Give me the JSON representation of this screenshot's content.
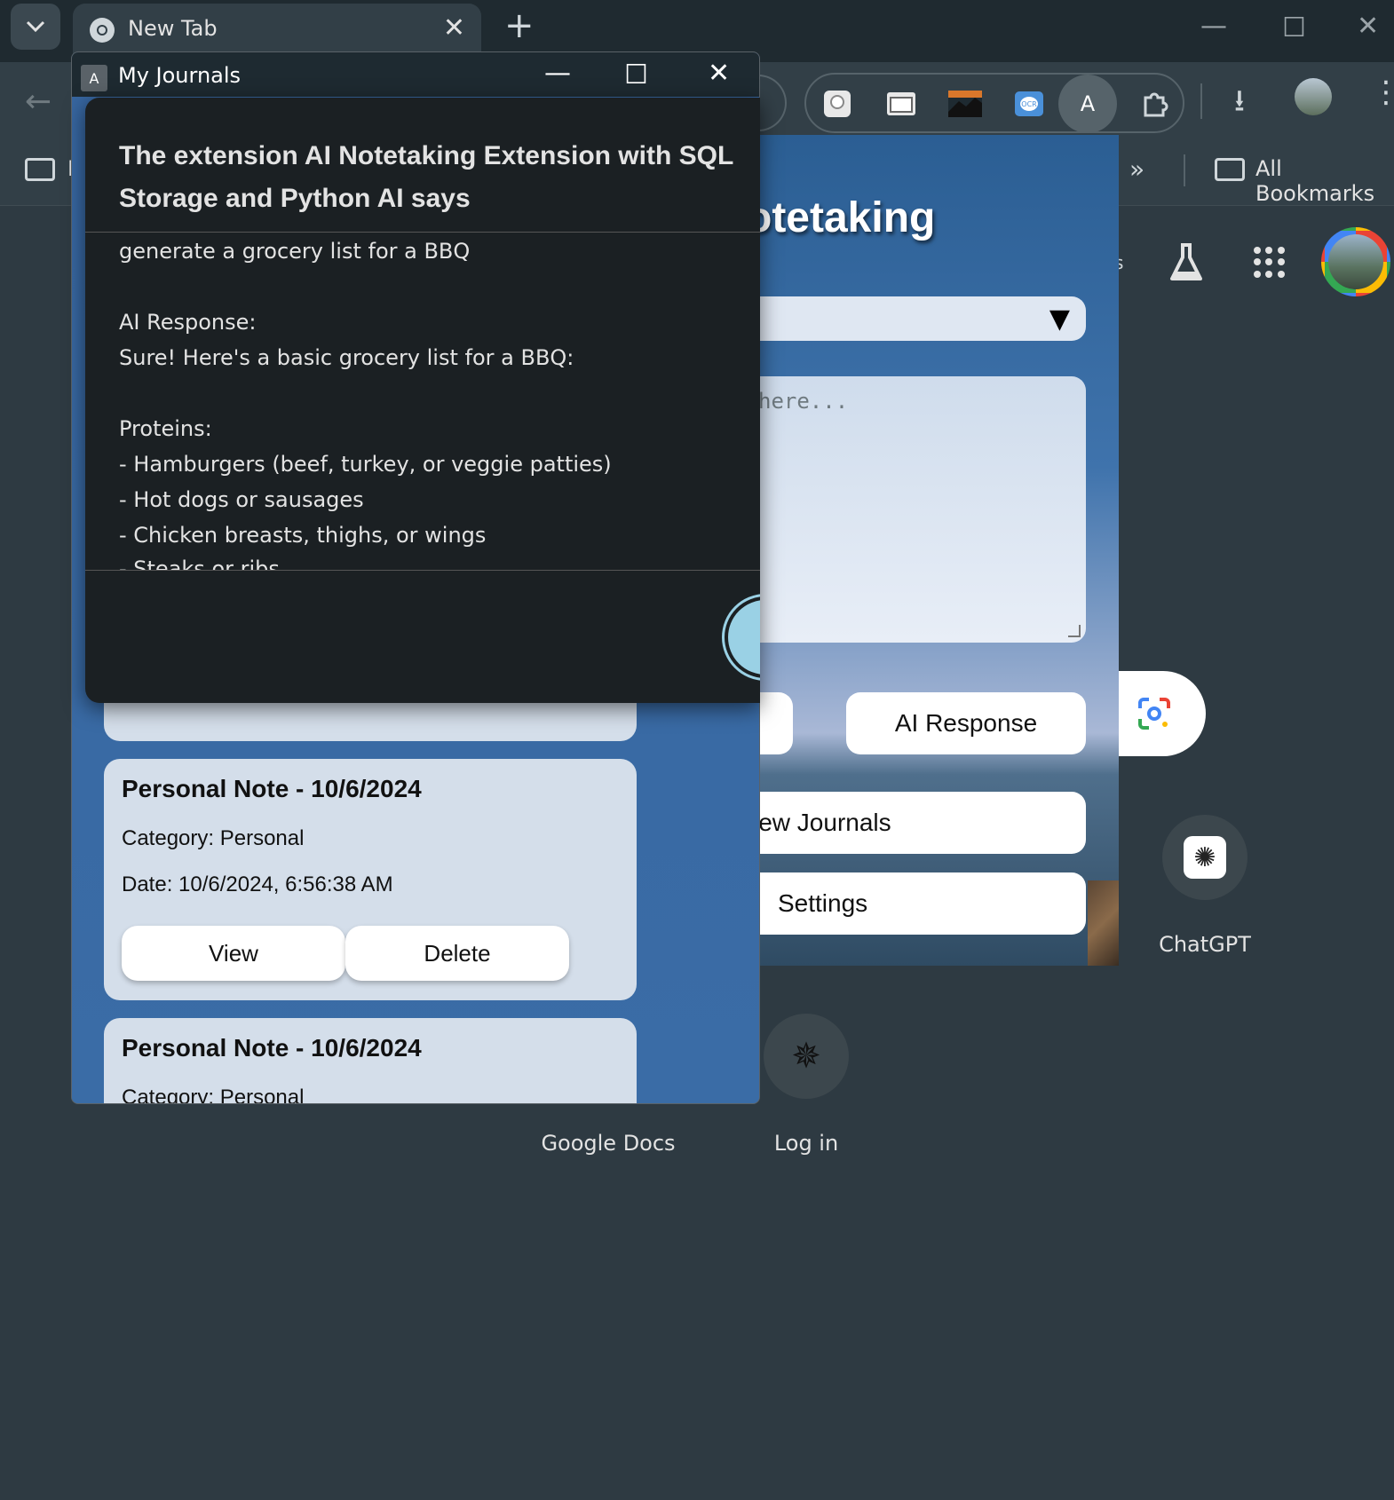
{
  "browser": {
    "tab_title": "New Tab",
    "tab_close": "✕",
    "new_tab": "+",
    "bookmark_more": "»",
    "bookmark_all": "All Bookmarks",
    "bookmark_partial": "I",
    "profile_letter": "A"
  },
  "ntp": {
    "partial_label": "s",
    "shortcuts": [
      {
        "label": "ChatGPT"
      },
      {
        "label": "Google Docs"
      },
      {
        "label": "Log in"
      }
    ]
  },
  "popup": {
    "title_fragment": "otetaking",
    "textarea_placeholder_fragment": "here...",
    "ai_response_button": "AI Response",
    "view_journals_fragment": "iew Journals",
    "settings_button": "Settings"
  },
  "journals_window": {
    "title": "My Journals",
    "app_icon_letter": "A",
    "notes": [
      {
        "title": "Personal Note - 10/6/2024",
        "category": "Category: Personal",
        "date": "Date: 10/6/2024, 6:56:38 AM",
        "view_label": "View",
        "delete_label": "Delete"
      },
      {
        "title": "Personal Note - 10/6/2024",
        "category": "Category: Personal"
      }
    ]
  },
  "dialog": {
    "heading": "The extension AI Notetaking Extension with SQL Storage and Python AI says",
    "lines": [
      "generate a grocery list for a BBQ",
      "AI Response:",
      "Sure! Here's a basic grocery list for a BBQ:",
      "Proteins:",
      "- Hamburgers (beef, turkey, or veggie patties)",
      "- Hot dogs or sausages",
      "- Chicken breasts, thighs, or wings",
      "- Steaks or ribs"
    ]
  }
}
